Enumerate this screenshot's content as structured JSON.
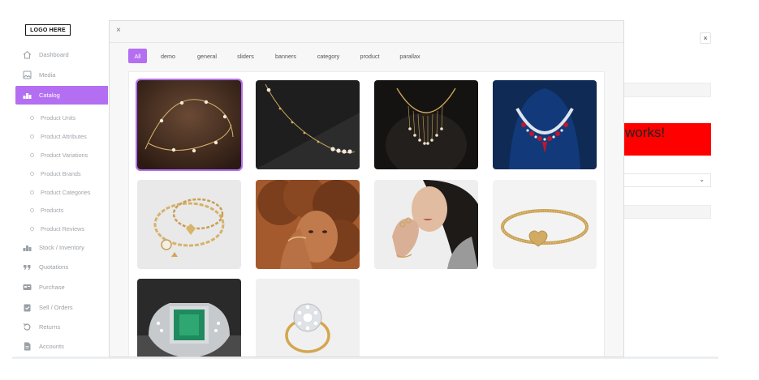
{
  "sidebar": {
    "logo": "LOGO HERE",
    "items": [
      {
        "label": "Dashboard",
        "icon": "home-icon"
      },
      {
        "label": "Media",
        "icon": "image-icon"
      },
      {
        "label": "Catalog",
        "icon": "catalog-icon",
        "active": true
      },
      {
        "label": "Stock / Inventory",
        "icon": "stock-icon"
      },
      {
        "label": "Quotations",
        "icon": "quote-icon"
      },
      {
        "label": "Purchase",
        "icon": "card-icon"
      },
      {
        "label": "Sell / Orders",
        "icon": "clipboard-icon"
      },
      {
        "label": "Returns",
        "icon": "undo-icon"
      },
      {
        "label": "Accounts",
        "icon": "document-icon"
      }
    ],
    "catalog_subitems": [
      "Product Units",
      "Product Attributes",
      "Product Variations",
      "Product Brands",
      "Product Categories",
      "Products",
      "Product Reviews"
    ]
  },
  "background": {
    "close_label": "×",
    "red_banner_text": "works!"
  },
  "modal": {
    "close_label": "×",
    "tabs": [
      "All",
      "demo",
      "general",
      "sliders",
      "banners",
      "category",
      "product",
      "parallax"
    ],
    "active_tab": "All",
    "images": [
      {
        "name": "gold-pearl-chain-necklace-image",
        "selected": true
      },
      {
        "name": "pearl-bead-chain-necklace-image",
        "selected": false
      },
      {
        "name": "fringe-pearl-collar-necklace-image",
        "selected": false
      },
      {
        "name": "ruby-diamond-necklace-image",
        "selected": false
      },
      {
        "name": "gold-charm-bracelet-image",
        "selected": false
      },
      {
        "name": "woman-curly-hair-bracelet-image",
        "selected": false
      },
      {
        "name": "woman-rings-bracelet-image",
        "selected": false
      },
      {
        "name": "gold-heart-clasp-bangle-image",
        "selected": false
      },
      {
        "name": "emerald-silver-ring-image",
        "selected": false
      },
      {
        "name": "diamond-cluster-gold-ring-image",
        "selected": false
      }
    ]
  },
  "colors": {
    "accent": "#b36ef2",
    "red_banner": "#ff0000"
  }
}
